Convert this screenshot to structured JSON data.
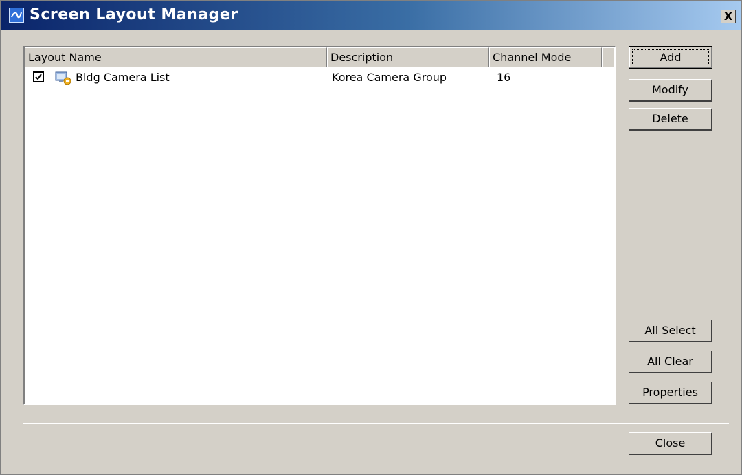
{
  "window": {
    "title": "Screen Layout Manager",
    "close_glyph": "X"
  },
  "list": {
    "columns": [
      "Layout Name",
      "Description",
      "Channel Mode"
    ],
    "rows": [
      {
        "checked": true,
        "icon": "camera-list-icon",
        "layout_name": "Bldg Camera List",
        "description": "Korea Camera Group",
        "channel_mode": "16"
      }
    ]
  },
  "buttons": {
    "add": "Add",
    "modify": "Modify",
    "delete": "Delete",
    "all_select": "All Select",
    "all_clear": "All Clear",
    "properties": "Properties",
    "close": "Close"
  },
  "colors": {
    "titlebar_start": "#0a246a",
    "titlebar_end": "#a6caf0",
    "face": "#d4d0c8"
  }
}
